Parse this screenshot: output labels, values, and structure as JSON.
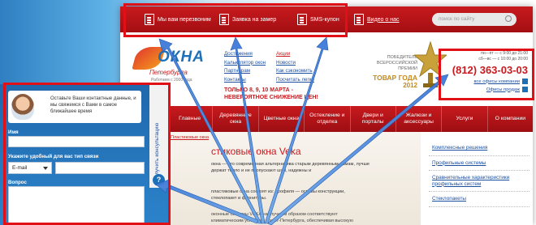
{
  "topbar": {
    "callback": "Мы вам перезвоним",
    "measurer": "Заявка на замер",
    "sms": "SMS-купон",
    "video": "Видео о нас",
    "search_placeholder": "поиск по сайту"
  },
  "logo": {
    "name": "ОКНА",
    "city": "Петербурга",
    "since": "Работаем с 2000 года"
  },
  "links_left": [
    "Достижения",
    "Калькулятор окон",
    "Партнерам",
    "Контакты"
  ],
  "links_right": [
    "Акции",
    "Новости",
    "Как сэкономить",
    "Посчитать легко"
  ],
  "promo": [
    "ТОЛЬКО 8, 9, 10 МАРТА -",
    "НЕВЕРОЯТНОЕ СНИЖЕНИЕ ЦЕН!"
  ],
  "award": {
    "line1": "ПОБЕДИТЕЛЬ",
    "line2": "ВСЕРОССИЙСКОЙ",
    "line3": "ПРЕМИИ",
    "title": "ТОВАР ГОДА",
    "year": "2012"
  },
  "contact": {
    "hours1": "пн—пт — с 9:00 до 21:00",
    "hours2": "сб—вс — с 10:00 до 20:00",
    "phone": "(812) 363-03-03",
    "all_offices": "все офисы компании",
    "sales_offices": "Офисы продаж"
  },
  "nav": [
    "Главные",
    "Деревянные окна",
    "Цветные окна",
    "Остекление и отделка",
    "Двери и порталы",
    "Жалюзи и аксессуары",
    "Услуги",
    "О компании"
  ],
  "breadcrumb": "Пластиковые окна",
  "heading": "стиковые окна Veka",
  "para1": "окна — это современная альтернатива старым деревянным рамам, лучше держат тепло и не пропускают шум, надежны и",
  "para2": "пластиковые окна состоят из: профиля — основы конструкции, стеклопакет и фурнитуры.",
  "para3": "оконные системы VEKA наилучшим образом соответствуют климатическим условиям Санкт-Петербурга, обеспечивая высокую уровень тепло- и",
  "sidebar": [
    "Комплексные решения",
    "Профильные системы",
    "Сравнительные характеристики профильных систем",
    "Стеклопакеты"
  ],
  "feedback": {
    "message": "Оставьте Ваши контактные данные, и мы свяжемся с Вами в самое ближайшее время",
    "tab_label": "Получить консультацию",
    "tab_icon": "?",
    "name_label": "Имя",
    "method_label": "Укажите удобный для вас тип связи",
    "method_value": "E-mail",
    "question_label": "Вопрос"
  },
  "colors": {
    "brand_red": "#c81a1e",
    "highlight": "#e10f16",
    "panel_blue": "#1f68ad",
    "link_blue": "#1d4fa0"
  }
}
